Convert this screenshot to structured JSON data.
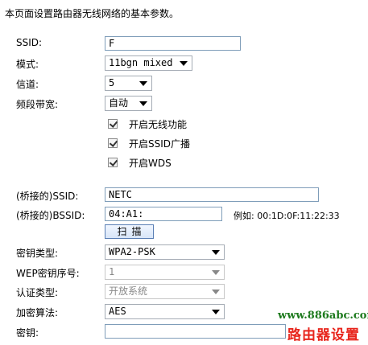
{
  "intro": "本页面设置路由器无线网络的基本参数。",
  "ssid": {
    "label": "SSID:",
    "value": "F"
  },
  "mode": {
    "label": "模式:",
    "value": "11bgn mixed"
  },
  "channel": {
    "label": "信道:",
    "value": "5"
  },
  "bandwidth": {
    "label": "频段带宽:",
    "value": "自动"
  },
  "checkboxes": [
    {
      "label": "开启无线功能",
      "checked": true
    },
    {
      "label": "开启SSID广播",
      "checked": true
    },
    {
      "label": "开启WDS",
      "checked": true
    }
  ],
  "bridged_ssid": {
    "label": "(桥接的)SSID:",
    "value": "NETC"
  },
  "bridged_bssid": {
    "label": "(桥接的)BSSID:",
    "value": "04:A1:",
    "example": "例如: 00:1D:0F:11:22:33"
  },
  "scan_button": "扫描",
  "key_type": {
    "label": "密钥类型:",
    "value": "WPA2-PSK"
  },
  "wep_index": {
    "label": "WEP密钥序号:",
    "value": "1"
  },
  "auth_type": {
    "label": "认证类型:",
    "value": "开放系统"
  },
  "encryption": {
    "label": "加密算法:",
    "value": "AES"
  },
  "key": {
    "label": "密钥:",
    "value": ""
  },
  "watermark": {
    "url": "www.886abc.com",
    "title": "路由器设置"
  },
  "colors": {
    "input_border": "#7f9db9",
    "watermark_green": "#1d7a1d",
    "watermark_red": "#e8251c"
  }
}
